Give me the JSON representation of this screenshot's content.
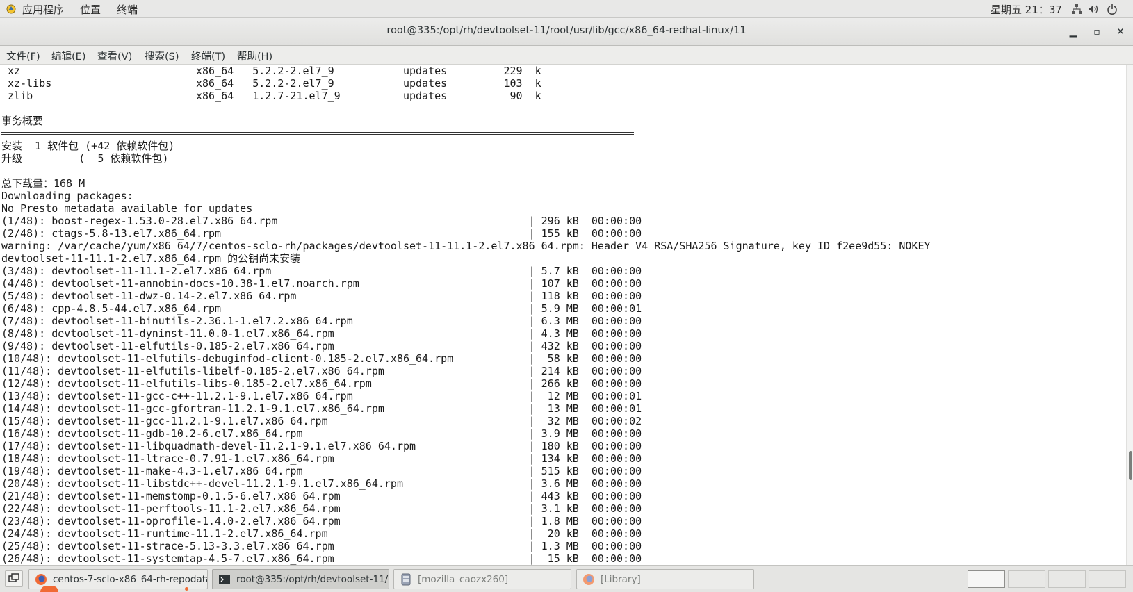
{
  "top_panel": {
    "menus": [
      "应用程序",
      "位置",
      "终端"
    ],
    "clock": "星期五 21：37",
    "tray_icons": [
      "network-icon",
      "volume-icon",
      "power-icon"
    ]
  },
  "window": {
    "title": "root@335:/opt/rh/devtoolset-11/root/usr/lib/gcc/x86_64-redhat-linux/11",
    "controls": [
      "minimize",
      "maximize",
      "close"
    ]
  },
  "menubar": [
    "文件(F)",
    "编辑(E)",
    "查看(V)",
    "搜索(S)",
    "终端(T)",
    "帮助(H)"
  ],
  "terminal": {
    "lines": [
      " xz                            x86_64   5.2.2-2.el7_9           updates         229  k",
      " xz-libs                       x86_64   5.2.2-2.el7_9           updates         103  k",
      " zlib                          x86_64   1.2.7-21.el7_9          updates          90  k",
      "",
      "事务概要",
      "__RULE__",
      "安装  1 软件包 (+42 依赖软件包)",
      "升级         (  5 依赖软件包)",
      "",
      "总下载量：168 M",
      "Downloading packages:",
      "No Presto metadata available for updates",
      "(1/48): boost-regex-1.53.0-28.el7.x86_64.rpm                                        | 296 kB  00:00:00",
      "(2/48): ctags-5.8-13.el7.x86_64.rpm                                                 | 155 kB  00:00:00",
      "warning: /var/cache/yum/x86_64/7/centos-sclo-rh/packages/devtoolset-11-11.1-2.el7.x86_64.rpm: Header V4 RSA/SHA256 Signature, key ID f2ee9d55: NOKEY",
      "devtoolset-11-11.1-2.el7.x86_64.rpm 的公钥尚未安装",
      "(3/48): devtoolset-11-11.1-2.el7.x86_64.rpm                                         | 5.7 kB  00:00:00",
      "(4/48): devtoolset-11-annobin-docs-10.38-1.el7.noarch.rpm                           | 107 kB  00:00:00",
      "(5/48): devtoolset-11-dwz-0.14-2.el7.x86_64.rpm                                     | 118 kB  00:00:00",
      "(6/48): cpp-4.8.5-44.el7.x86_64.rpm                                                 | 5.9 MB  00:00:01",
      "(7/48): devtoolset-11-binutils-2.36.1-1.el7.2.x86_64.rpm                            | 6.3 MB  00:00:00",
      "(8/48): devtoolset-11-dyninst-11.0.0-1.el7.x86_64.rpm                               | 4.3 MB  00:00:00",
      "(9/48): devtoolset-11-elfutils-0.185-2.el7.x86_64.rpm                               | 432 kB  00:00:00",
      "(10/48): devtoolset-11-elfutils-debuginfod-client-0.185-2.el7.x86_64.rpm            |  58 kB  00:00:00",
      "(11/48): devtoolset-11-elfutils-libelf-0.185-2.el7.x86_64.rpm                       | 214 kB  00:00:00",
      "(12/48): devtoolset-11-elfutils-libs-0.185-2.el7.x86_64.rpm                         | 266 kB  00:00:00",
      "(13/48): devtoolset-11-gcc-c++-11.2.1-9.1.el7.x86_64.rpm                            |  12 MB  00:00:01",
      "(14/48): devtoolset-11-gcc-gfortran-11.2.1-9.1.el7.x86_64.rpm                       |  13 MB  00:00:01",
      "(15/48): devtoolset-11-gcc-11.2.1-9.1.el7.x86_64.rpm                                |  32 MB  00:00:02",
      "(16/48): devtoolset-11-gdb-10.2-6.el7.x86_64.rpm                                    | 3.9 MB  00:00:00",
      "(17/48): devtoolset-11-libquadmath-devel-11.2.1-9.1.el7.x86_64.rpm                  | 180 kB  00:00:00",
      "(18/48): devtoolset-11-ltrace-0.7.91-1.el7.x86_64.rpm                               | 134 kB  00:00:00",
      "(19/48): devtoolset-11-make-4.3-1.el7.x86_64.rpm                                    | 515 kB  00:00:00",
      "(20/48): devtoolset-11-libstdc++-devel-11.2.1-9.1.el7.x86_64.rpm                    | 3.6 MB  00:00:00",
      "(21/48): devtoolset-11-memstomp-0.1.5-6.el7.x86_64.rpm                              | 443 kB  00:00:00",
      "(22/48): devtoolset-11-perftools-11.1-2.el7.x86_64.rpm                              | 3.1 kB  00:00:00",
      "(23/48): devtoolset-11-oprofile-1.4.0-2.el7.x86_64.rpm                              | 1.8 MB  00:00:00",
      "(24/48): devtoolset-11-runtime-11.1-2.el7.x86_64.rpm                                |  20 kB  00:00:00",
      "(25/48): devtoolset-11-strace-5.13-3.3.el7.x86_64.rpm                               | 1.3 MB  00:00:00",
      "(26/48): devtoolset-11-systemtap-4.5-7.el7.x86_64.rpm                               |  15 kB  00:00:00"
    ],
    "scroll_position": 0.82
  },
  "taskbar": {
    "tasks": [
      {
        "label": "centos-7-sclo-x86_64-rh-repodata...",
        "icon": "firefox-icon",
        "state": "normal"
      },
      {
        "label": "root@335:/opt/rh/devtoolset-11/r...",
        "icon": "terminal-icon",
        "state": "active"
      },
      {
        "label": "[mozilla_caozx260]",
        "icon": "file-manager-icon",
        "state": "dim"
      },
      {
        "label": "[Library]",
        "icon": "firefox-icon",
        "state": "dim"
      }
    ],
    "workspaces": 4,
    "current_workspace": 1
  },
  "colors": {
    "terminal_bg": "#ffffff",
    "terminal_fg": "#1a1a1a",
    "panel_bg": "#e8e8e7",
    "accent_orange": "#f06a35"
  }
}
